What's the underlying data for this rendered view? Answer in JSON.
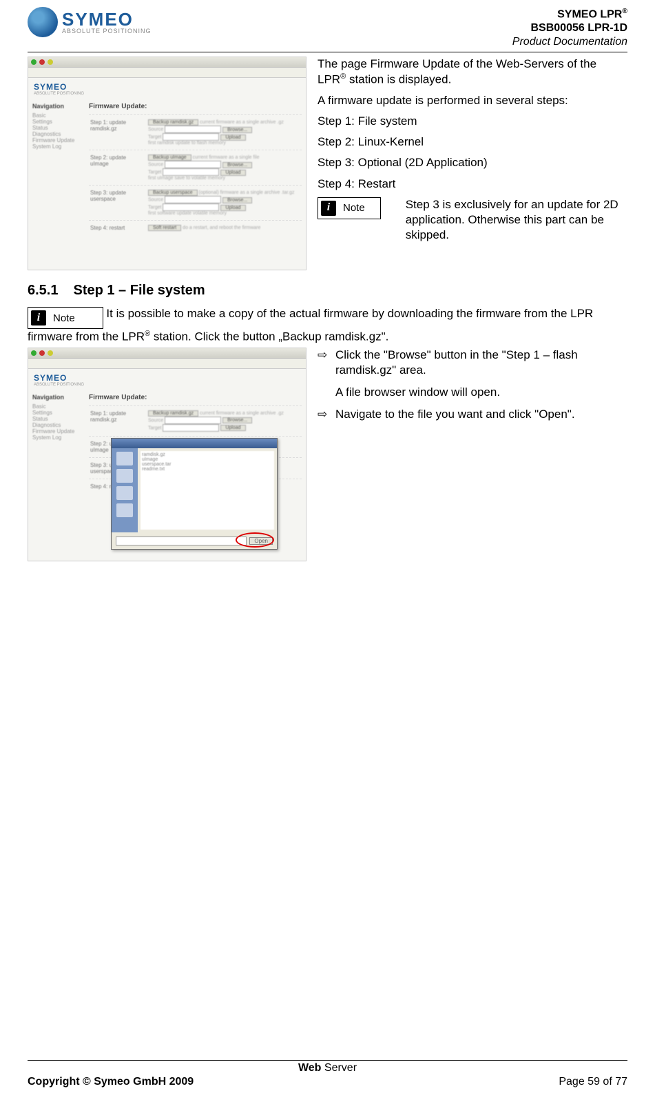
{
  "header": {
    "logo_name": "SYMEO",
    "logo_tagline": "ABSOLUTE POSITIONING",
    "right_line1_prefix": "SYMEO LPR",
    "right_line1_sup": "®",
    "right_line2": "BSB00056 LPR-1D",
    "right_line3": "Product Documentation"
  },
  "block1": {
    "text": {
      "p1_a": "The page Firmware Update of the Web-Servers of the LPR",
      "p1_sup": "®",
      "p1_b": " station is displayed.",
      "p2": "A firmware update is performed in several steps:",
      "s1": "Step 1: File system",
      "s2": "Step 2: Linux-Kernel",
      "s3": "Step 3: Optional (2D Application)",
      "s4": "Step 4: Restart",
      "note_label": "Note",
      "note_text": "Step 3 is exclusively for an update for 2D application. Otherwise this part can be skipped."
    },
    "mock": {
      "nav_title": "Navigation",
      "main_title": "Firmware Update:",
      "step1": "Step 1: update ramdisk.gz",
      "step2": "Step 2: update uImage",
      "step3": "Step 3: update userspace",
      "step4": "Step 4: restart",
      "backup_btn": "Backup ramdisk.gz",
      "browse_btn": "Browse...",
      "upload_btn": "Upload"
    }
  },
  "section": {
    "num": "6.5.1",
    "title": "Step 1 – File system"
  },
  "note2": {
    "label": "Note",
    "text_a": "It is possible to make a copy of the actual firmware by downloading the firmware from the LPR",
    "sup": "®",
    "text_b": " station. Click the button „Backup ramdisk.gz\"."
  },
  "block2": {
    "li1": "Click the \"Browse\" button in the \"Step 1 – flash ramdisk.gz\" area.",
    "li1b": "A file browser window will open.",
    "li2": "Navigate to the file you want and click \"Open\".",
    "mock": {
      "nav_title": "Navigation",
      "main_title": "Firmware Update:",
      "open_btn": "Open"
    }
  },
  "footer": {
    "center_bold": "Web",
    "center_rest": " Server",
    "copyright": "Copyright © Symeo GmbH 2009",
    "page": "Page 59 of 77"
  },
  "glyphs": {
    "arrow": "⇨"
  }
}
